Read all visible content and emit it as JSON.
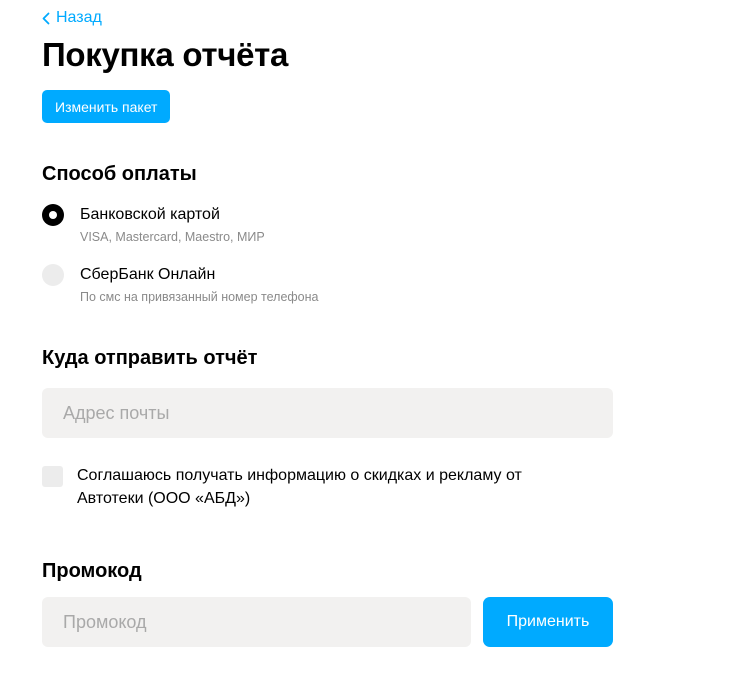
{
  "nav": {
    "back_label": "Назад"
  },
  "header": {
    "title": "Покупка отчёта",
    "change_package_label": "Изменить пакет"
  },
  "payment": {
    "title": "Способ оплаты",
    "options": [
      {
        "label": "Банковской картой",
        "sublabel": "VISA, Mastercard, Maestro, МИР",
        "selected": true
      },
      {
        "label": "СберБанк Онлайн",
        "sublabel": "По смс на привязанный номер телефона",
        "selected": false
      }
    ]
  },
  "delivery": {
    "title": "Куда отправить отчёт",
    "email_placeholder": "Адрес почты",
    "email_value": "",
    "consent_label": "Соглашаюсь получать информацию о скидках и рекламу от Автотеки (ООО «АБД»)",
    "consent_checked": false
  },
  "promo": {
    "title": "Промокод",
    "placeholder": "Промокод",
    "value": "",
    "apply_label": "Применить"
  },
  "colors": {
    "accent": "#00aaff",
    "input_bg": "#f2f1f0",
    "muted_text": "#8a8a8a"
  },
  "icons": {
    "back": "chevron-left-icon"
  }
}
